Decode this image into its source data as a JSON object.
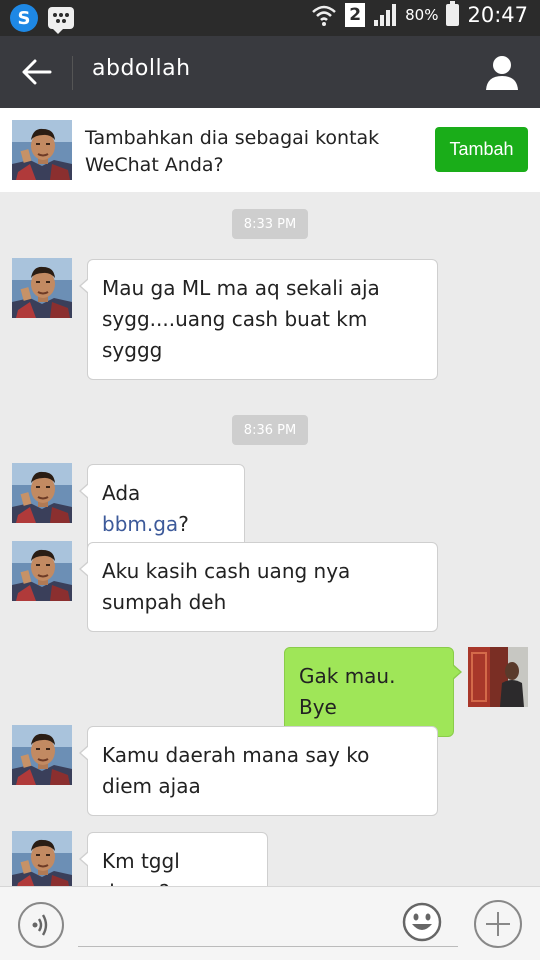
{
  "status_bar": {
    "sim_label": "2",
    "battery_percent": "80%",
    "battery_level": 0.8,
    "time": "20:47",
    "icons": [
      "s-app-icon",
      "bbm-icon",
      "wifi-icon",
      "sim-icon",
      "signal-icon",
      "battery-icon"
    ]
  },
  "header": {
    "title": "abdollah",
    "back_icon": "arrow-left-icon",
    "profile_icon": "person-icon"
  },
  "add_contact": {
    "prompt": "Tambahkan dia sebagai kontak WeChat Anda?",
    "button_label": "Tambah",
    "button_color": "#1aad19"
  },
  "messages": {
    "ts1": "8:33 PM",
    "m1": "Mau ga ML ma aq sekali aja sygg....uang cash buat km syggg",
    "ts2": "8:36 PM",
    "m2_prefix": "Ada ",
    "m2_link": "bbm.ga",
    "m2_suffix": "?",
    "m3": "Aku kasih cash uang nya sumpah deh",
    "m4": "Gak mau. Bye",
    "m5": "Kamu daerah mana say ko diem ajaa",
    "m6": "Km tggl dmna?"
  },
  "input_bar": {
    "voice_icon": "voice-icon",
    "emoji_icon": "smiley-icon",
    "plus_icon": "plus-icon"
  },
  "colors": {
    "header_bg": "#393a3f",
    "status_bg": "#2b2b2b",
    "chat_bg": "#ebebeb",
    "outgoing_bubble": "#9fe658",
    "incoming_bubble": "#ffffff",
    "link": "#3d5a9a"
  }
}
